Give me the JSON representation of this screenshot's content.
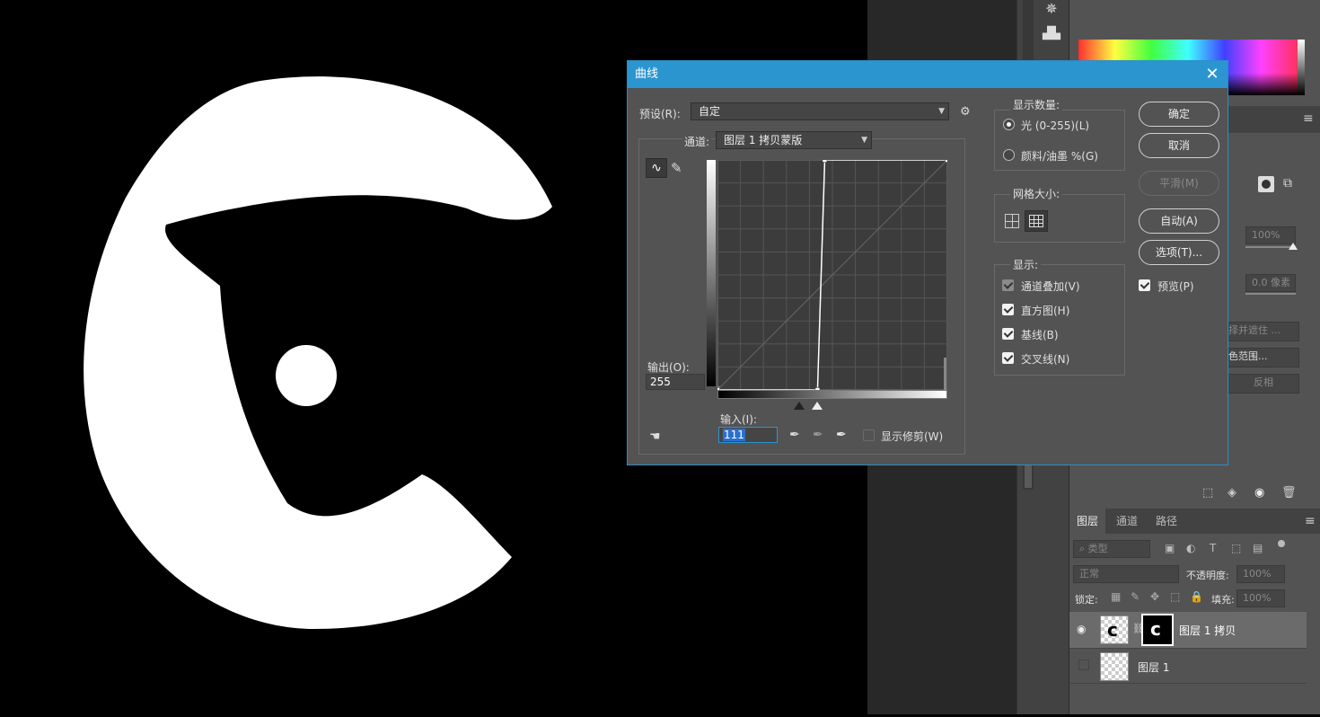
{
  "dialog": {
    "title": "曲线",
    "preset_label": "预设(R):",
    "preset_value": "自定",
    "channel_label": "通道:",
    "channel_value": "图层 1 拷贝蒙版",
    "output_label": "输出(O):",
    "output_value": "255",
    "input_label": "输入(I):",
    "input_value": "111",
    "show_clipping_label": "显示修剪(W)",
    "show_amount": {
      "title": "显示数量:",
      "light_label": "光 (0-255)(L)",
      "pigment_label": "颜料/油墨 %(G)",
      "selected": "light"
    },
    "grid_size": {
      "title": "网格大小:"
    },
    "show": {
      "title": "显示:",
      "channel_overlay": {
        "label": "通道叠加(V)",
        "checked": true,
        "disabled": true
      },
      "histogram": {
        "label": "直方图(H)",
        "checked": true
      },
      "baseline": {
        "label": "基线(B)",
        "checked": true
      },
      "intersection": {
        "label": "交叉线(N)",
        "checked": true
      }
    },
    "buttons": {
      "ok": "确定",
      "cancel": "取消",
      "smooth": "平滑(M)",
      "auto": "自动(A)",
      "options": "选项(T)..."
    },
    "preview": {
      "label": "预览(P)",
      "checked": true
    },
    "curve": {
      "points": [
        [
          0,
          0
        ],
        [
          111,
          0
        ],
        [
          119,
          255
        ],
        [
          255,
          255
        ]
      ]
    }
  },
  "properties_panel": {
    "density_value": "100%",
    "feather_value": "0.0 像素",
    "select_and_mask_label": "择并遮住 ...",
    "color_range_label": "色范围...",
    "invert_label": "反相"
  },
  "layers_panel": {
    "tabs": [
      "图层",
      "通道",
      "路径"
    ],
    "filter_label": "类型",
    "blend_mode": "正常",
    "opacity_label": "不透明度:",
    "opacity_value": "100%",
    "lock_label": "锁定:",
    "fill_label": "填充:",
    "fill_value": "100%",
    "layers": [
      {
        "name": "图层 1 拷贝",
        "visible": true,
        "selected": true
      },
      {
        "name": "图层 1",
        "visible": false,
        "selected": false
      }
    ]
  }
}
